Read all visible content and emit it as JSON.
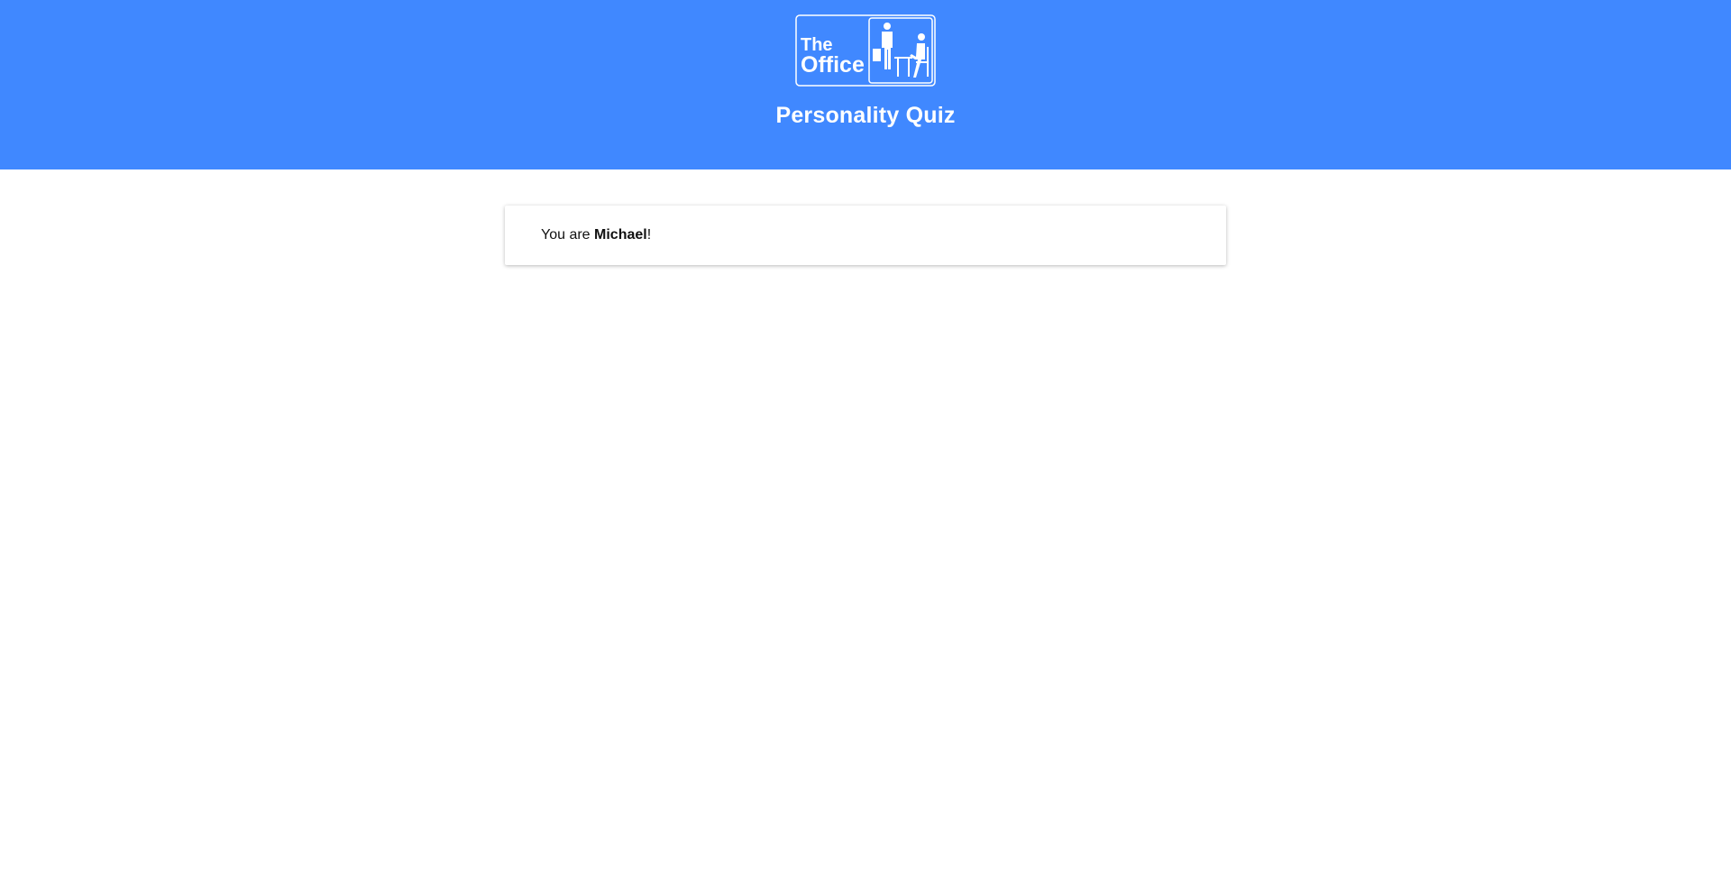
{
  "header": {
    "logo": {
      "text_line1": "The",
      "text_line2": "Office",
      "icon": "the-office-logo"
    },
    "title": "Personality Quiz"
  },
  "result": {
    "prefix": "You are ",
    "character": "Michael",
    "suffix": "!"
  },
  "colors": {
    "header_bg": "#4088ff",
    "header_text": "#ffffff",
    "page_bg": "#ffffff",
    "card_text": "#111111"
  }
}
